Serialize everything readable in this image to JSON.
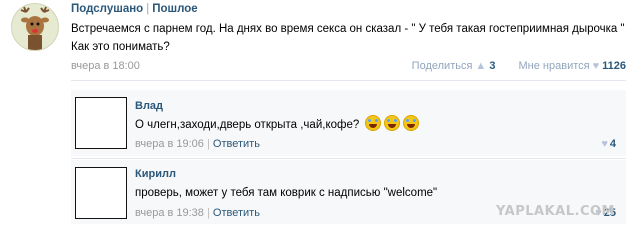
{
  "post": {
    "group_name": "Подслушано",
    "separator": "|",
    "group_tag": "Пошлое",
    "text": "Встречаемся с парнем год. На днях во время секса он сказал - \" У тебя такая гостеприимная дырочка \" Как это понимать?",
    "date": "вчера в 18:00",
    "share_label": "Поделиться",
    "share_icon": "megaphone-icon",
    "share_count": "3",
    "like_label": "Мне нравится",
    "like_icon": "heart-icon",
    "like_count": "1126"
  },
  "comments": [
    {
      "author": "Влад",
      "text": "О члегн,заходи,дверь открыта ,чай,кофе?",
      "emoji_count": 3,
      "date": "вчера в 19:06",
      "reply_label": "Ответить",
      "likes": "4",
      "like_icon": "heart-icon"
    },
    {
      "author": "Кирилл",
      "text": "проверь, может у тебя там коврик с надписью \"welcome\"",
      "date": "вчера в 19:38",
      "reply_label": "Ответить",
      "likes": "25",
      "like_icon": "heart-icon"
    }
  ],
  "watermark": "YAPLAKAL.COM",
  "colors": {
    "link": "#2b587a",
    "muted": "#999999",
    "icon": "#b6c6d8",
    "reply_bg": "#f7f8fa"
  }
}
